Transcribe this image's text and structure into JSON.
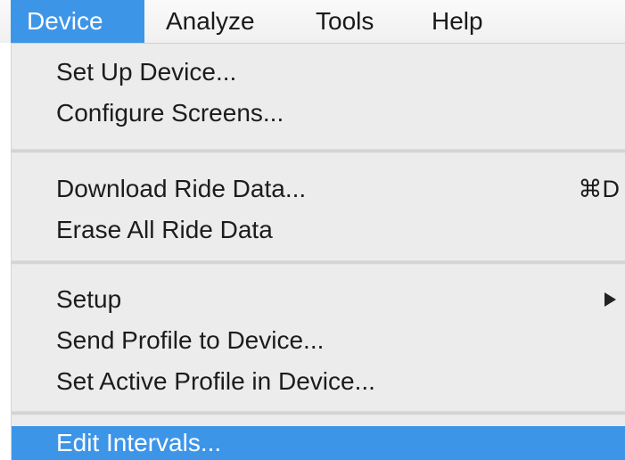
{
  "menubar": {
    "items": [
      {
        "label": "Device",
        "active": true
      },
      {
        "label": "Analyze",
        "active": false
      },
      {
        "label": "Tools",
        "active": false
      },
      {
        "label": "Help",
        "active": false
      }
    ]
  },
  "menu": {
    "group1": [
      {
        "label": "Set Up Device..."
      },
      {
        "label": "Configure Screens..."
      }
    ],
    "group2": [
      {
        "label": "Download Ride Data...",
        "shortcut": "⌘D"
      },
      {
        "label": "Erase All Ride Data"
      }
    ],
    "group3": [
      {
        "label": "Setup",
        "has_submenu": true
      },
      {
        "label": "Send Profile to Device..."
      },
      {
        "label": "Set Active Profile in Device..."
      }
    ],
    "group4": [
      {
        "label": "Edit Intervals...",
        "highlighted": true
      }
    ]
  },
  "colors": {
    "accent": "#3d95e8",
    "menu_background": "#ececec",
    "separator": "#d4d4d4",
    "text": "#1c1c1c"
  },
  "icons": {
    "submenu": "triangle-right-icon"
  }
}
